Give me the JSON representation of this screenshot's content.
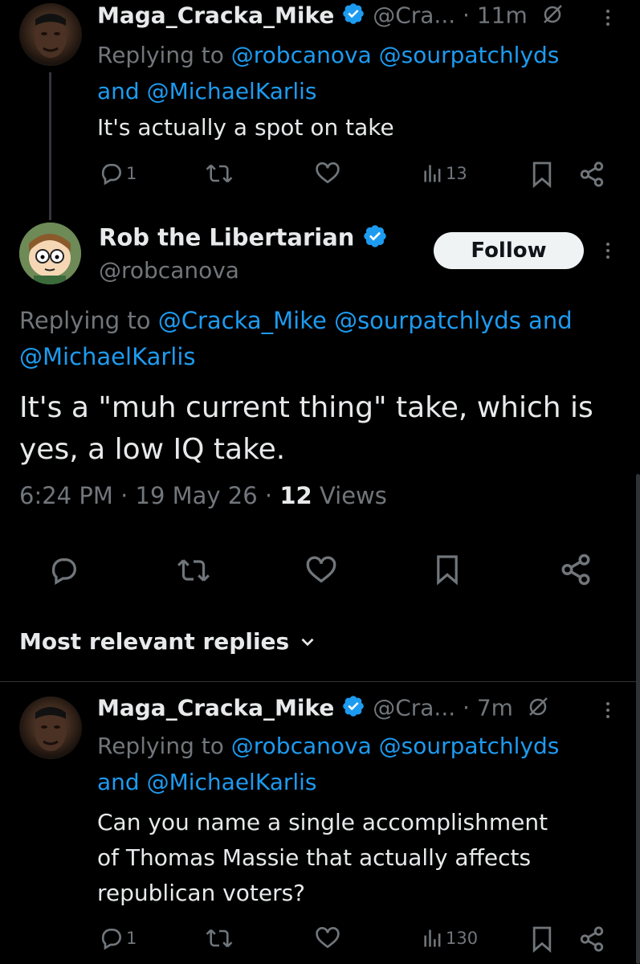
{
  "reply1": {
    "display_name": "Maga_Cracka_Mike",
    "handle": "@Cra...",
    "time": "· 11m",
    "replying_prefix": "Replying to",
    "mention_1": "@robcanova",
    "mention_2": "@sourpatchlyds",
    "mention_joiner": "and",
    "mention_3": "@MichaelKarlis",
    "text": "It's actually a spot on take",
    "reply_count": "1",
    "views_count": "13"
  },
  "main_tweet": {
    "display_name": "Rob the Libertarian",
    "handle": "@robcanova",
    "follow_label": "Follow",
    "replying_prefix": "Replying to",
    "mention_1": "@Cracka_Mike",
    "mention_2": "@sourpatchlyds",
    "mention_joiner": "and",
    "mention_3": "@MichaelKarlis",
    "text_line1": "It's a \"muh current thing\" take, which is",
    "text_line2": "yes, a low IQ take.",
    "timestamp": "6:24 PM · 19 May 26 ·",
    "views_count": "12",
    "views_label": "Views"
  },
  "replies_sort": {
    "label": "Most relevant replies"
  },
  "reply2": {
    "display_name": "Maga_Cracka_Mike",
    "handle": "@Cra...",
    "time": "· 7m",
    "replying_prefix": "Replying to",
    "mention_1": "@robcanova",
    "mention_2": "@sourpatchlyds",
    "mention_joiner": "and",
    "mention_3": "@MichaelKarlis",
    "text_line1": "Can you name a single accomplishment",
    "text_line2": "of Thomas Massie that actually affects",
    "text_line3": "republican voters?",
    "reply_count": "1",
    "views_count": "130"
  },
  "colors": {
    "background": "#000000",
    "text": "#e7e9ea",
    "secondary": "#71767b",
    "link": "#1d9bf0",
    "verified": "#1d9bf0"
  },
  "icons": [
    "reply-icon",
    "retweet-icon",
    "like-icon",
    "views-icon",
    "bookmark-icon",
    "share-icon",
    "verified-badge-icon",
    "more-icon",
    "muted-icon",
    "chevron-down-icon"
  ]
}
